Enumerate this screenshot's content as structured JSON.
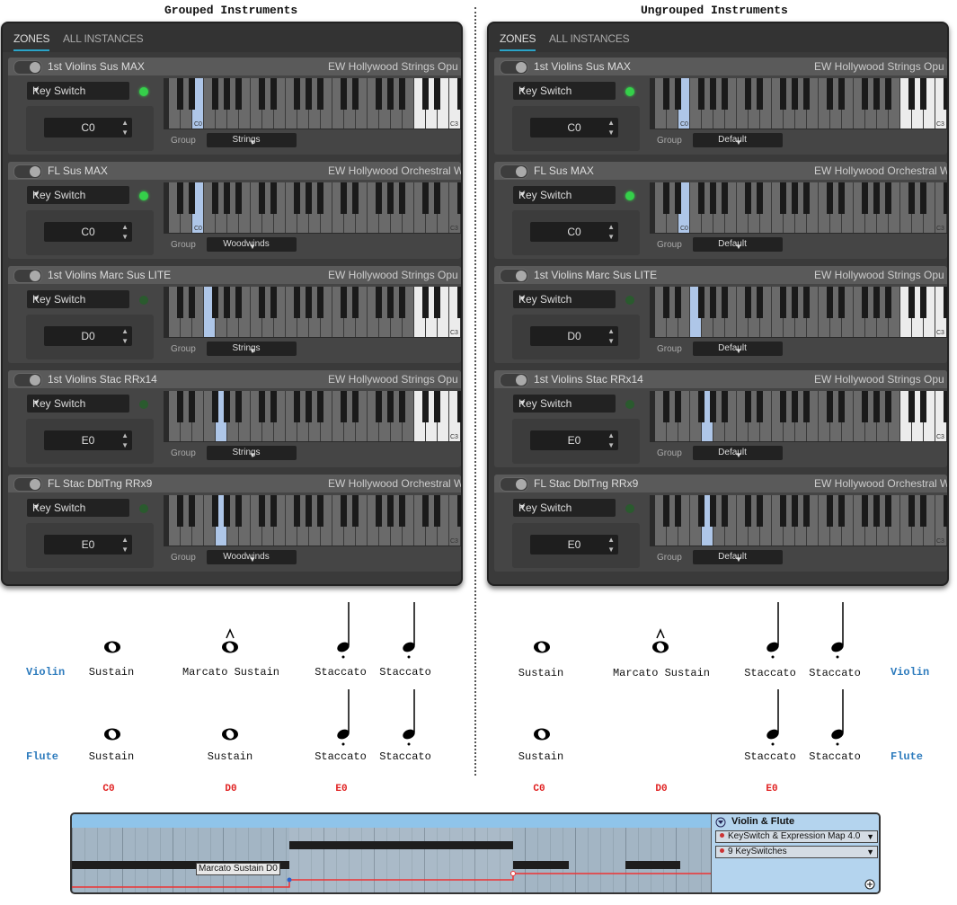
{
  "headings": {
    "left": "Grouped Instruments",
    "right": "Ungrouped Instruments"
  },
  "tabs": {
    "zones": "ZONES",
    "all": "ALL INSTANCES"
  },
  "common": {
    "keyswitch_label": "Key Switch",
    "group_label": "Group"
  },
  "zones": [
    {
      "name": "1st Violins Sus MAX",
      "library": "EW Hollywood Strings Opu",
      "note": "C0",
      "group_grouped": "Strings",
      "group_ungrouped": "Default",
      "led": "on",
      "hl_label": "C0"
    },
    {
      "name": "FL Sus MAX",
      "library": "EW Hollywood Orchestral W",
      "note": "C0",
      "group_grouped": "Woodwinds",
      "group_ungrouped": "Default",
      "led": "on",
      "hl_label": "C0"
    },
    {
      "name": "1st Violins Marc Sus LITE",
      "library": "EW Hollywood Strings Opu",
      "note": "D0",
      "group_grouped": "Strings",
      "group_ungrouped": "Default",
      "led": "off",
      "hl_label": ""
    },
    {
      "name": "1st Violins Stac RRx14",
      "library": "EW Hollywood Strings Opu",
      "note": "E0",
      "group_grouped": "Strings",
      "group_ungrouped": "Default",
      "led": "off",
      "hl_label": ""
    },
    {
      "name": "FL Stac DblTng RRx9",
      "library": "EW Hollywood Orchestral W",
      "note": "E0",
      "group_grouped": "Woodwinds",
      "group_ungrouped": "Default",
      "led": "off",
      "hl_label": ""
    }
  ],
  "keyboard_label": "C3",
  "score": {
    "violin": "Violin",
    "flute": "Flute",
    "labels": {
      "sustain": "Sustain",
      "marcato": "Marcato Sustain",
      "staccato": "Staccato"
    },
    "keys": {
      "c0": "C0",
      "d0": "D0",
      "e0": "E0"
    }
  },
  "daw": {
    "track": "Violin & Flute",
    "map": "KeySwitch & Expression Map 4.0",
    "keyswitches": "9 KeySwitches",
    "tooltip": "Marcato Sustain D0",
    "add_icon": "plus-circle-icon"
  },
  "colors": {
    "led_on": "#35d04a",
    "highlight_key": "#aec6e8",
    "instrument": "#2d7bbd",
    "keyswitch": "#e02020",
    "tab_accent": "#2aa4c8"
  }
}
